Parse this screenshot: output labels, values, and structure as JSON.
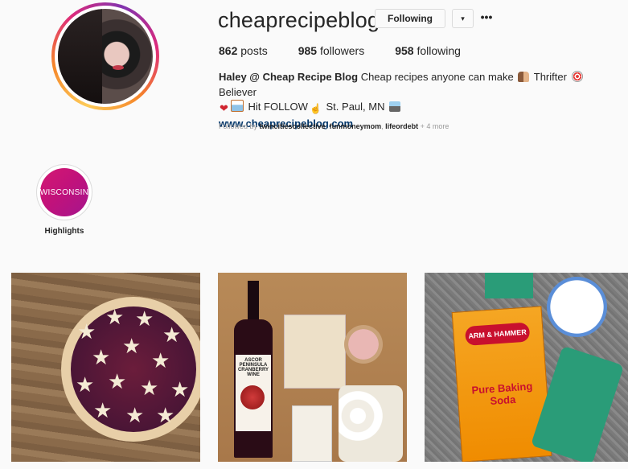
{
  "profile": {
    "username": "cheaprecipeblog",
    "following_label": "Following",
    "dropdown_label": "▾",
    "more_label": "•••",
    "stats": {
      "posts_count": "862",
      "posts_label": "posts",
      "followers_count": "985",
      "followers_label": "followers",
      "following_count": "958",
      "following_label": "following"
    },
    "bio": {
      "name": "Haley @ Cheap Recipe Blog",
      "line1_text": "Cheap recipes anyone can make",
      "thrifter": "Thrifter",
      "believer": "Believer",
      "hit_follow": "Hit FOLLOW",
      "location": "St. Paul, MN",
      "link": "www.cheaprecipeblog.com"
    },
    "followed_by": {
      "prefix": "Followed by",
      "names": [
        "twincitiescollective",
        "funmoneymom",
        "lifeordebt"
      ],
      "more": "+ 4 more"
    }
  },
  "highlights": {
    "items": [
      {
        "cover_text": "WISCONSIN",
        "label": "Highlights"
      }
    ]
  },
  "posts": {
    "post2_text": "ASCOR PENINSULA",
    "post2_sub": "CRANBERRY WINE",
    "post3_brand": "ARM & HAMMER",
    "post3_product": "Pure Baking Soda"
  },
  "colors": {
    "link": "#003569",
    "highlight_gradient_start": "#d41872",
    "highlight_gradient_end": "#a5158e",
    "background": "#fafafa"
  },
  "icons": [
    "avatar",
    "chevron-down-icon",
    "more-options-icon"
  ]
}
